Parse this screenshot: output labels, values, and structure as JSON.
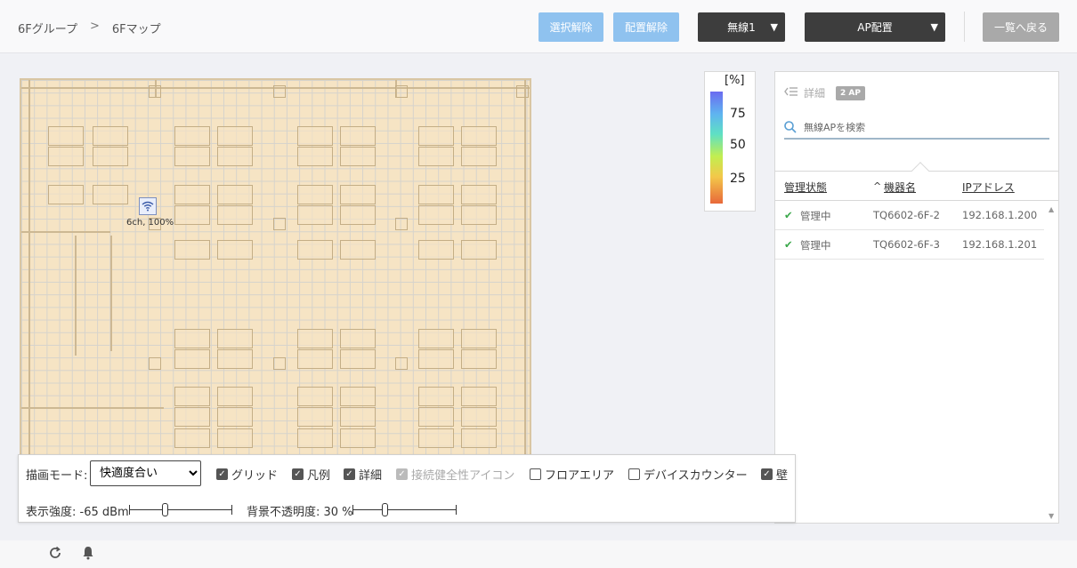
{
  "breadcrumb": {
    "group": "6Fグループ",
    "separator": ">",
    "current": "6Fマップ"
  },
  "toolbar": {
    "deselect_label": "選択解除",
    "unplace_label": "配置解除",
    "radio_label": "無線1",
    "ap_place_label": "AP配置",
    "back_label": "一覧へ戻る"
  },
  "map": {
    "ap_label": "6ch, 100%"
  },
  "legend": {
    "unit": "[%]",
    "ticks": [
      "75",
      "50",
      "25"
    ]
  },
  "detail": {
    "title": "詳細",
    "badge": "2 AP",
    "search_placeholder": "無線APを検索",
    "columns": [
      "管理状態",
      "機器名",
      "IPアドレス"
    ],
    "sort_indicator": "^",
    "rows": [
      {
        "status": "管理中",
        "name": "TQ6602-6F-2",
        "ip": "192.168.1.200"
      },
      {
        "status": "管理中",
        "name": "TQ6602-6F-3",
        "ip": "192.168.1.201"
      }
    ]
  },
  "controls": {
    "mode_label": "描画モード:",
    "mode_value": "快適度合い",
    "checkboxes": [
      {
        "label": "グリッド",
        "checked": true,
        "disabled": false
      },
      {
        "label": "凡例",
        "checked": true,
        "disabled": false
      },
      {
        "label": "詳細",
        "checked": true,
        "disabled": false
      },
      {
        "label": "接続健全性アイコン",
        "checked": true,
        "disabled": true
      },
      {
        "label": "フロアエリア",
        "checked": false,
        "disabled": false
      },
      {
        "label": "デバイスカウンター",
        "checked": false,
        "disabled": false
      },
      {
        "label": "壁",
        "checked": true,
        "disabled": false
      }
    ],
    "strength_label": "表示強度: -65 dBm",
    "opacity_label": "背景不透明度: 30 %"
  },
  "icons": [
    "refresh-icon",
    "bell-icon",
    "search-icon",
    "collapse-icon",
    "wifi-icon",
    "check-icon"
  ],
  "colors": {
    "accent_light": "#8fc2ef",
    "dark_button": "#3d3d3d",
    "status_ok": "#3aa84a"
  }
}
